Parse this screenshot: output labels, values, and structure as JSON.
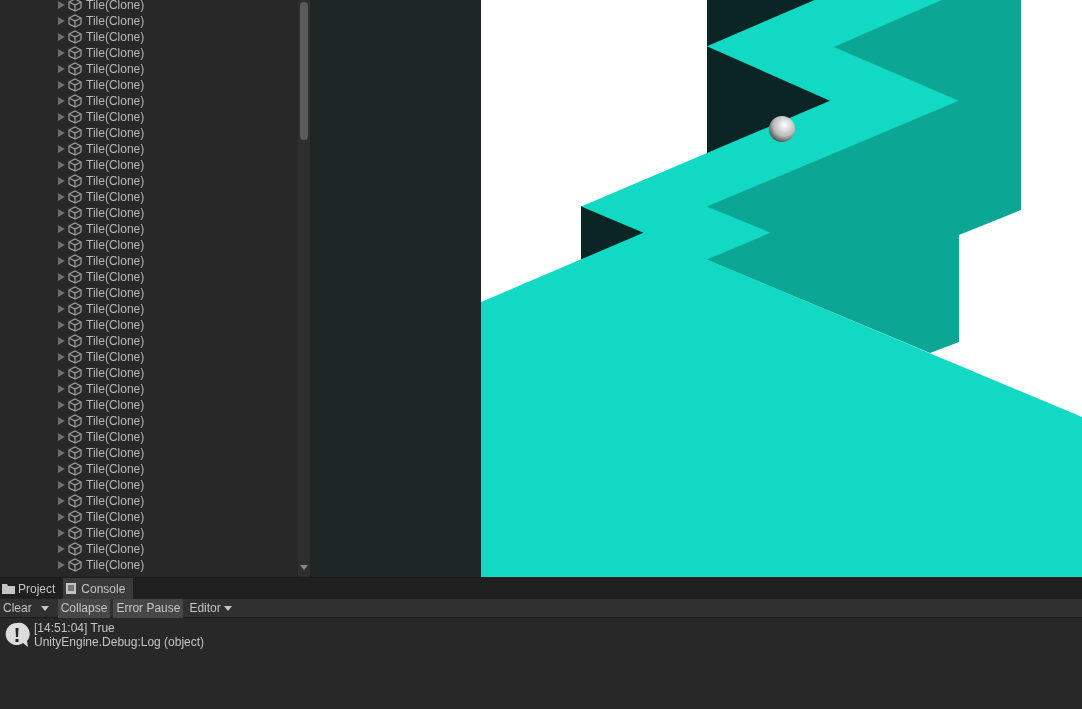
{
  "hierarchy": {
    "items": [
      {
        "label": "Tile(Clone)",
        "expanded": false
      },
      {
        "label": "Tile(Clone)",
        "expanded": false
      },
      {
        "label": "Tile(Clone)",
        "expanded": false
      },
      {
        "label": "Tile(Clone)",
        "expanded": false
      },
      {
        "label": "Tile(Clone)",
        "expanded": false
      },
      {
        "label": "Tile(Clone)",
        "expanded": false
      },
      {
        "label": "Tile(Clone)",
        "expanded": false
      },
      {
        "label": "Tile(Clone)",
        "expanded": false
      },
      {
        "label": "Tile(Clone)",
        "expanded": false
      },
      {
        "label": "Tile(Clone)",
        "expanded": false
      },
      {
        "label": "Tile(Clone)",
        "expanded": false
      },
      {
        "label": "Tile(Clone)",
        "expanded": false
      },
      {
        "label": "Tile(Clone)",
        "expanded": false
      },
      {
        "label": "Tile(Clone)",
        "expanded": false
      },
      {
        "label": "Tile(Clone)",
        "expanded": false
      },
      {
        "label": "Tile(Clone)",
        "expanded": false
      },
      {
        "label": "Tile(Clone)",
        "expanded": false
      },
      {
        "label": "Tile(Clone)",
        "expanded": false
      },
      {
        "label": "Tile(Clone)",
        "expanded": false
      },
      {
        "label": "Tile(Clone)",
        "expanded": false
      },
      {
        "label": "Tile(Clone)",
        "expanded": false
      },
      {
        "label": "Tile(Clone)",
        "expanded": false
      },
      {
        "label": "Tile(Clone)",
        "expanded": false
      },
      {
        "label": "Tile(Clone)",
        "expanded": false
      },
      {
        "label": "Tile(Clone)",
        "expanded": false
      },
      {
        "label": "Tile(Clone)",
        "expanded": false
      },
      {
        "label": "Tile(Clone)",
        "expanded": false
      },
      {
        "label": "Tile(Clone)",
        "expanded": false
      },
      {
        "label": "Tile(Clone)",
        "expanded": false
      },
      {
        "label": "Tile(Clone)",
        "expanded": false
      },
      {
        "label": "Tile(Clone)",
        "expanded": false
      },
      {
        "label": "Tile(Clone)",
        "expanded": false
      },
      {
        "label": "Tile(Clone)",
        "expanded": false
      },
      {
        "label": "Tile(Clone)",
        "expanded": false
      },
      {
        "label": "Tile(Clone)",
        "expanded": false
      },
      {
        "label": "Tile(Clone)",
        "expanded": false
      }
    ]
  },
  "bottom_panel": {
    "tabs": [
      {
        "label": "Project",
        "kind": "folder",
        "selected": false
      },
      {
        "label": "Console",
        "kind": "console",
        "selected": true
      }
    ],
    "toolbar": [
      {
        "label": "Clear",
        "kind": "split"
      },
      {
        "label": "Collapse",
        "kind": "toggle",
        "on": true
      },
      {
        "label": "Error Pause",
        "kind": "toggle",
        "on": true
      },
      {
        "label": "Editor",
        "kind": "dropdown"
      }
    ],
    "log_entries": [
      {
        "message": "[14:51:04] True",
        "trace": "UnityEngine.Debug:Log (object)"
      }
    ]
  }
}
